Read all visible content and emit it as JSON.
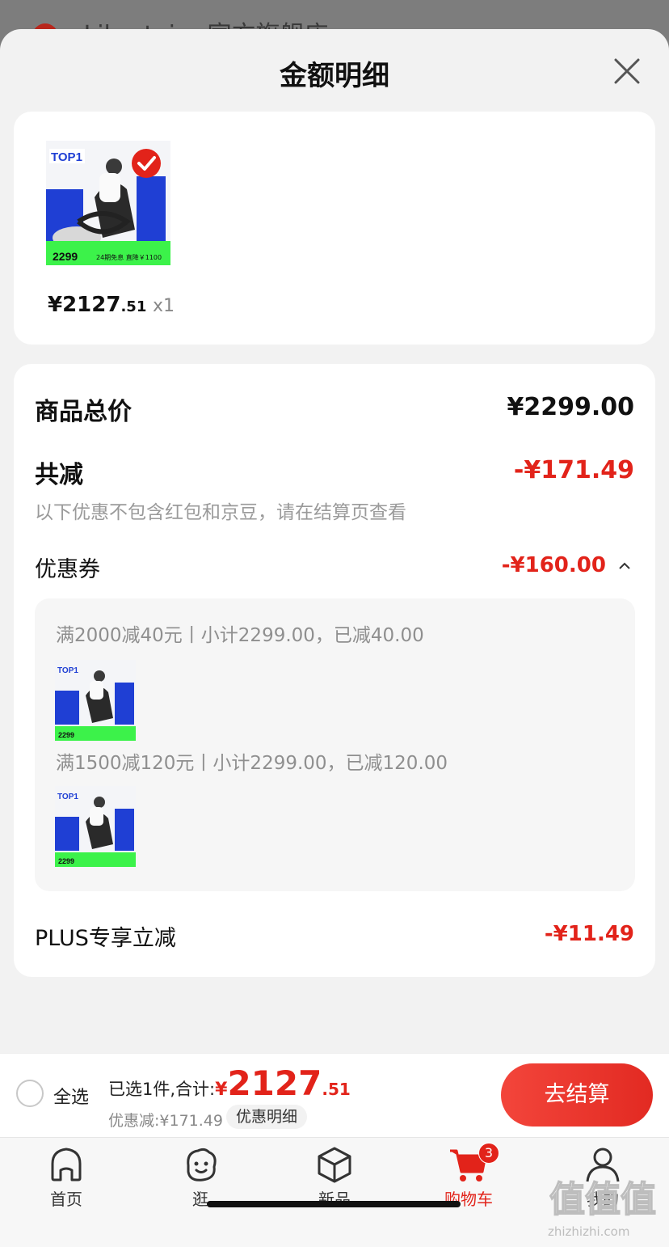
{
  "background": {
    "store_name": "Libertaire 官方旗舰店 ›"
  },
  "sheet": {
    "title": "金额明细"
  },
  "product": {
    "thumb_top_label": "TOP1",
    "thumb_price": "2299",
    "thumb_promo": "24期免息 直降￥1100",
    "price_main": "¥2127",
    "price_decimal": ".51",
    "quantity": "x1"
  },
  "detail": {
    "total_label": "商品总价",
    "total_value": "¥2299.00",
    "reduce_label": "共减",
    "reduce_value": "-¥171.49",
    "note": "以下优惠不包含红包和京豆，请在结算页查看",
    "coupon_label": "优惠券",
    "coupon_value": "-¥160.00",
    "coupons": [
      {
        "text": "满2000减40元丨小计2299.00，已减40.00"
      },
      {
        "text": "满1500减120元丨小计2299.00，已减120.00"
      }
    ],
    "plus_label": "PLUS专享立减",
    "plus_value": "-¥11.49"
  },
  "checkout": {
    "select_all": "全选",
    "selected_text": "已选1件,合计:",
    "yen": "¥",
    "total_int": "2127",
    "total_dec": ".51",
    "discount_text": "优惠减:¥171.49",
    "detail_pill": "优惠明细",
    "button": "去结算"
  },
  "tabs": [
    {
      "label": "首页",
      "icon": "home-icon"
    },
    {
      "label": "逛",
      "icon": "face-icon"
    },
    {
      "label": "新品",
      "icon": "cube-icon"
    },
    {
      "label": "购物车",
      "icon": "cart-icon",
      "badge": "3",
      "active": true
    },
    {
      "label": "我的",
      "icon": "user-icon"
    }
  ],
  "watermark": {
    "text": "zhizhizhi.com",
    "logo": "值值值"
  },
  "colors": {
    "accent": "#e2231a",
    "thumb_green": "#3cf24a",
    "thumb_blue": "#1f3fd4"
  }
}
